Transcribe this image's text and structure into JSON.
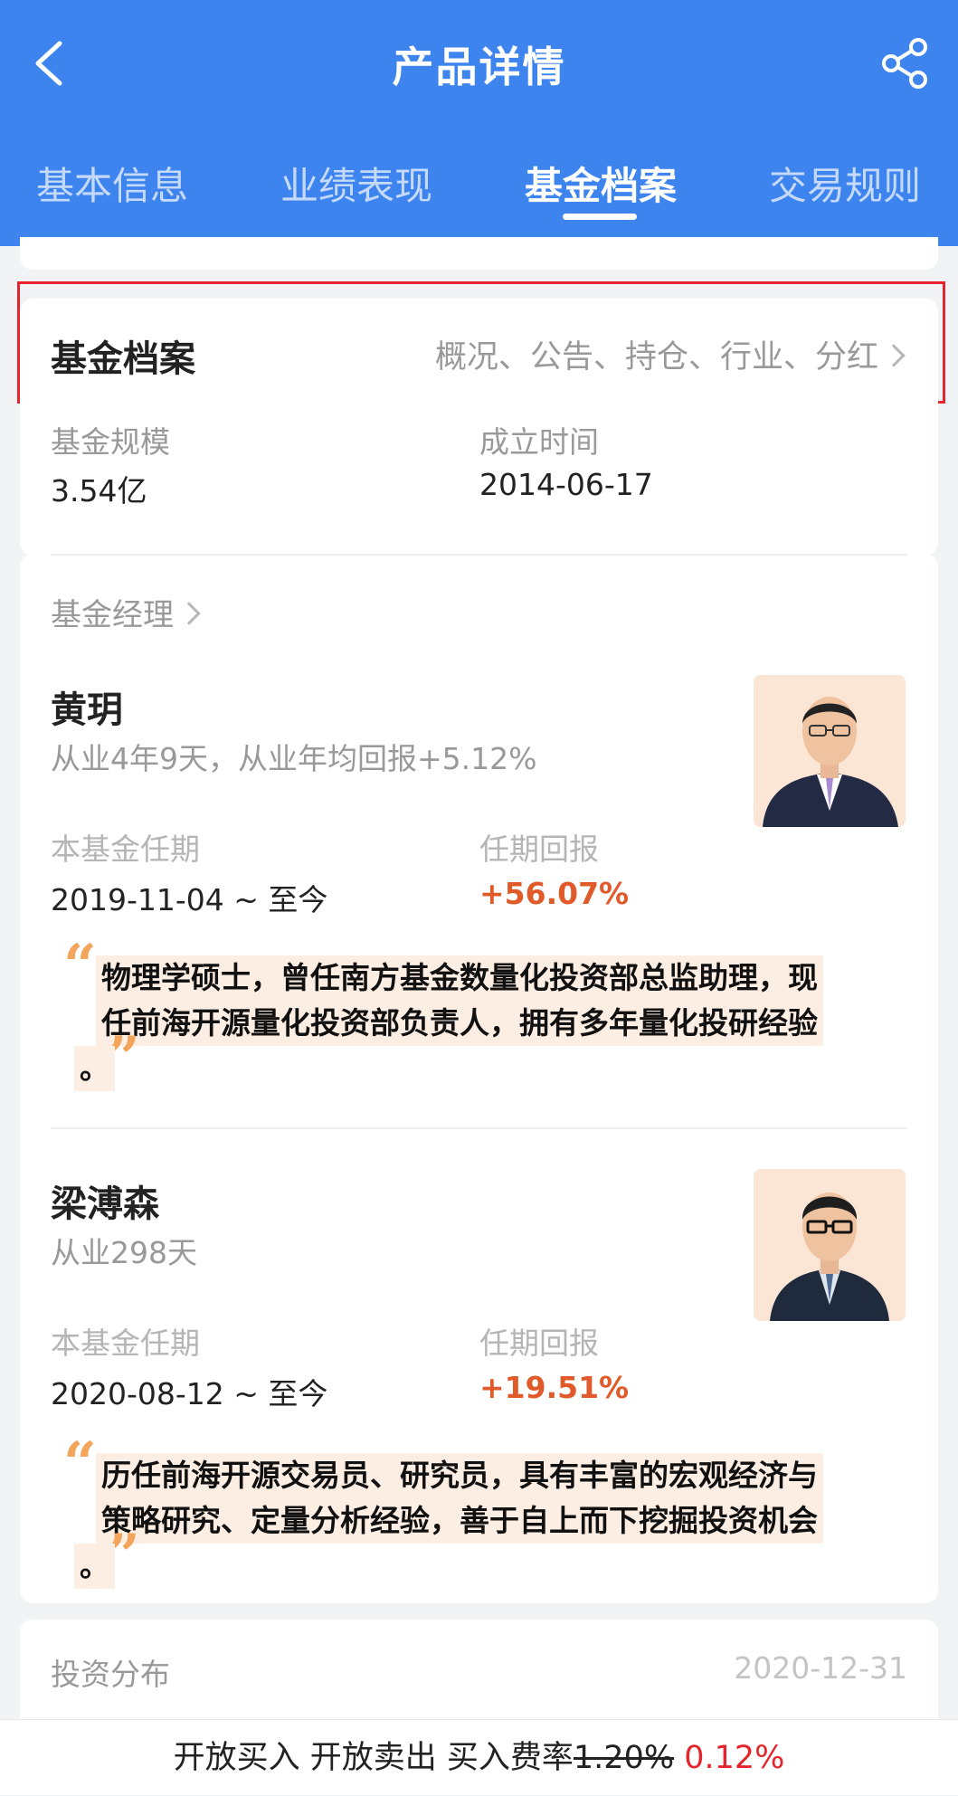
{
  "header": {
    "title": "产品详情",
    "tabs": [
      {
        "label": "基本信息"
      },
      {
        "label": "业绩表现"
      },
      {
        "label": "基金档案"
      },
      {
        "label": "交易规则"
      }
    ],
    "bg_color": "#3d84ee"
  },
  "archive": {
    "title": "基金档案",
    "links": "概况、公告、持仓、行业、分红"
  },
  "info": {
    "scale_label": "基金规模",
    "scale_value": "3.54亿",
    "founded_label": "成立时间",
    "founded_value": "2014-06-17"
  },
  "managers_section": {
    "label": "基金经理",
    "managers": [
      {
        "name": "黄玥",
        "experience": "从业4年9天，从业年均回报+5.12%",
        "tenure_label": "本基金任期",
        "tenure_value": "2019-11-04 ~ 至今",
        "return_label": "任期回报",
        "return_value": "+56.07%",
        "bio_line1": "物理学硕士，曾任南方基金数量化投资部总监助理，现",
        "bio_line2": "任前海开源量化投资部负责人，拥有多年量化投研经验",
        "bio_line3": "。"
      },
      {
        "name": "梁溥森",
        "experience": "从业298天",
        "tenure_label": "本基金任期",
        "tenure_value": "2020-08-12 ~ 至今",
        "return_label": "任期回报",
        "return_value": "+19.51%",
        "bio_line1": "历任前海开源交易员、研究员，具有丰富的宏观经济与",
        "bio_line2": "策略研究、定量分析经验，善于自上而下挖掘投资机会",
        "bio_line3": "。"
      }
    ]
  },
  "distribution": {
    "label": "投资分布",
    "date": "2020-12-31"
  },
  "footer": {
    "buy_status": "开放买入",
    "sell_status": "开放卖出",
    "fee_label": "买入费率",
    "fee_old": "1.20%",
    "fee_new": "0.12%"
  }
}
